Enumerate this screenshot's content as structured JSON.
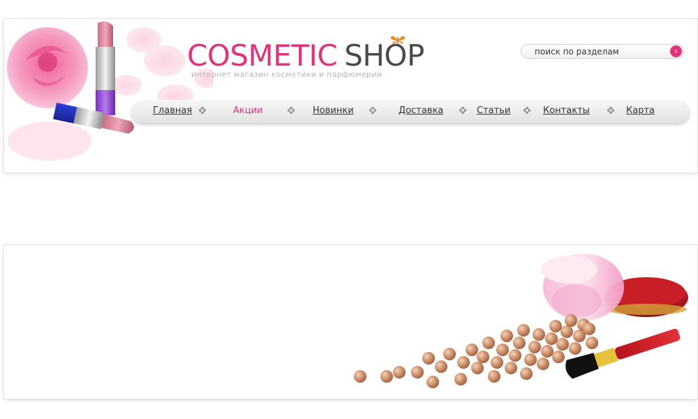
{
  "header": {
    "logo_word1": "COSMETIC",
    "logo_word2": "SHOP",
    "tagline": "интернет магазин косметики и парфюмерии"
  },
  "search": {
    "placeholder": "поиск по разделам",
    "button_glyph": "›"
  },
  "nav": {
    "items": [
      {
        "label": "Главная",
        "active": false
      },
      {
        "label": "Акции",
        "active": true
      },
      {
        "label": "Новинки",
        "active": false
      },
      {
        "label": "Доставка ",
        "active": false
      },
      {
        "label": "Статьи",
        "active": false
      },
      {
        "label": "Контакты",
        "active": false
      },
      {
        "label": "Карта",
        "active": false
      }
    ]
  },
  "colors": {
    "accent": "#e6307a",
    "text": "#333333",
    "logo_dark": "#4a4a4a",
    "tagline": "#b8b8b8"
  },
  "icons": {
    "butterfly": "butterfly-icon",
    "nav_separator": "flower-icon",
    "search": "arrow-right-icon"
  }
}
